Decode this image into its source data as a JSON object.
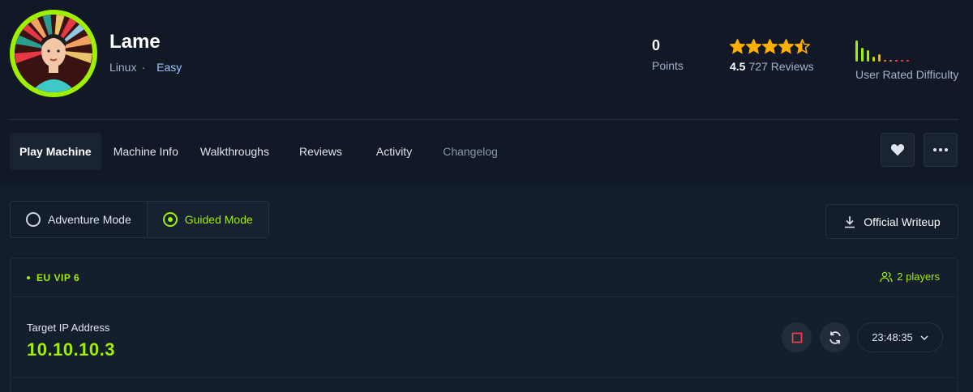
{
  "machine": {
    "name": "Lame",
    "os": "Linux",
    "separator": "·",
    "difficulty": "Easy"
  },
  "stats": {
    "points_value": "0",
    "points_label": "Points",
    "rating_value": "4.5",
    "stars_rating": 4.5,
    "reviews_label": "727 Reviews",
    "difficulty_label": "User Rated Difficulty",
    "difficulty_bars": [
      0.85,
      0.55,
      0.45,
      0.2,
      0.3,
      0.06,
      0.06,
      0.06,
      0.06,
      0.06
    ]
  },
  "tabs": [
    {
      "label": "Play Machine"
    },
    {
      "label": "Machine Info"
    },
    {
      "label": "Walkthroughs"
    },
    {
      "label": "Reviews"
    },
    {
      "label": "Activity"
    },
    {
      "label": "Changelog"
    }
  ],
  "modes": {
    "adventure": "Adventure Mode",
    "guided": "Guided Mode",
    "selected": "guided"
  },
  "writeup_label": "Official Writeup",
  "server": {
    "name": "EU VIP 6",
    "players": "2 players"
  },
  "target": {
    "label": "Target IP Address",
    "ip": "10.10.10.3",
    "timer": "23:48:35"
  },
  "colors": {
    "accent": "#9fef00",
    "star": "#ffaf00",
    "stop": "#ff3e3e",
    "background": "#141d2b"
  },
  "icons": {
    "favorite": "heart-icon",
    "more": "ellipsis-icon",
    "download": "download-icon",
    "players": "users-icon",
    "stop": "stop-icon",
    "reset": "refresh-icon",
    "dropdown": "chevron-down-icon"
  }
}
